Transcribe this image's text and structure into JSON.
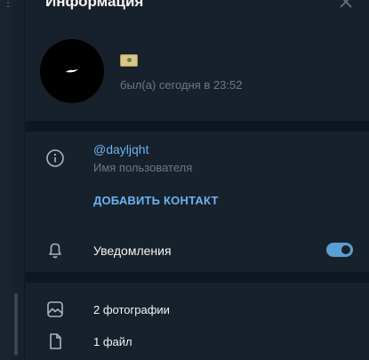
{
  "header": {
    "title": "Информация"
  },
  "profile": {
    "status": "был(а) сегодня в 23:52"
  },
  "info": {
    "username": "@dayljqht",
    "username_caption": "Имя пользователя",
    "add_contact_label": "ДОБАВИТЬ КОНТАКТ"
  },
  "notifications": {
    "label": "Уведомления",
    "enabled": true
  },
  "media": {
    "photos_label": "2 фотографии",
    "files_label": "1 файл"
  },
  "colors": {
    "background": "#17212b",
    "divider": "#0e1621",
    "accent": "#6ab3f3",
    "muted_text": "#6c7883"
  }
}
